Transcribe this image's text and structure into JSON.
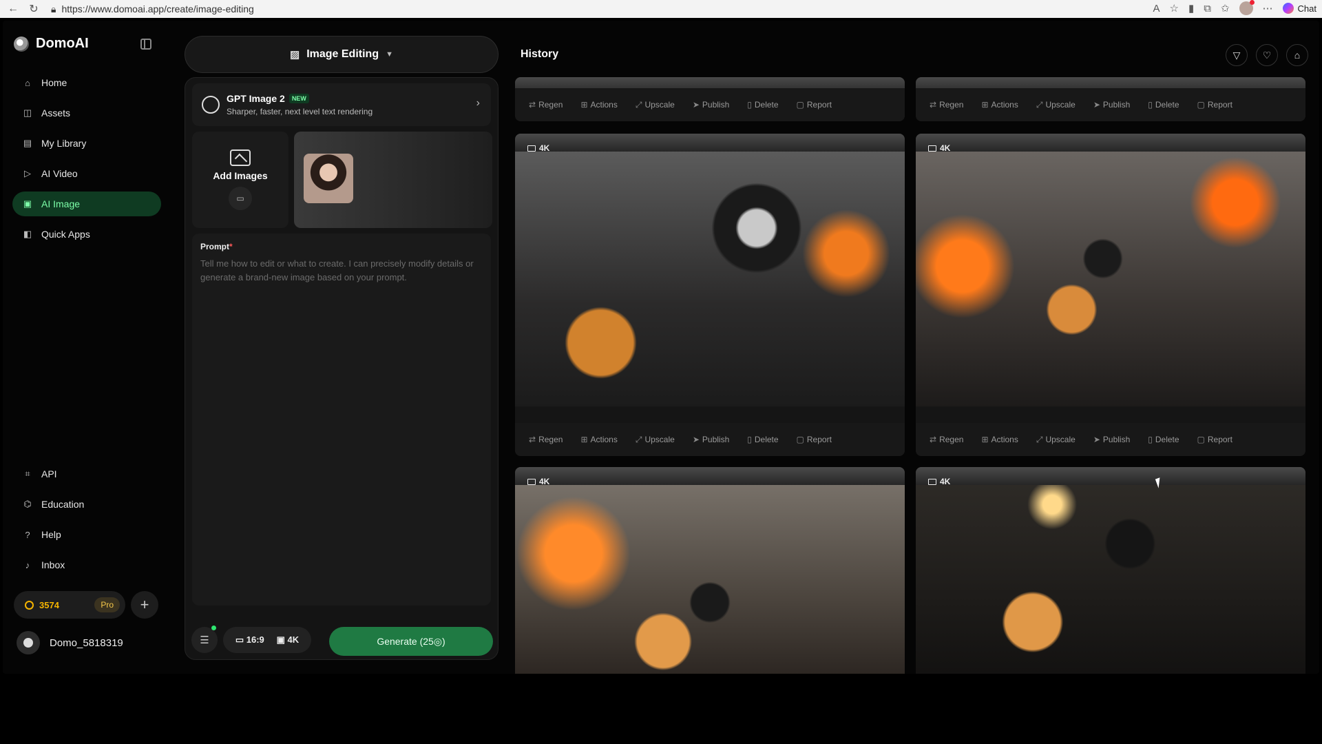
{
  "browser": {
    "url": "https://www.domoai.app/create/image-editing",
    "chat_label": "Chat"
  },
  "sidebar": {
    "brand": "DomoAI",
    "items": [
      {
        "label": "Home",
        "icon": "home-icon"
      },
      {
        "label": "Assets",
        "icon": "assets-icon"
      },
      {
        "label": "My Library",
        "icon": "library-icon"
      },
      {
        "label": "AI Video",
        "icon": "video-icon"
      },
      {
        "label": "AI Image",
        "icon": "image-icon",
        "active": true
      },
      {
        "label": "Quick Apps",
        "icon": "apps-icon"
      }
    ],
    "bottom_items": [
      {
        "label": "API",
        "icon": "api-icon"
      },
      {
        "label": "Education",
        "icon": "education-icon"
      },
      {
        "label": "Help",
        "icon": "help-icon"
      },
      {
        "label": "Inbox",
        "icon": "bell-icon"
      }
    ],
    "credits": "3574",
    "plan": "Pro",
    "username": "Domo_5818319"
  },
  "editor": {
    "mode": "Image Editing",
    "model_name": "GPT Image 2",
    "model_badge": "NEW",
    "model_desc": "Sharper, faster, next level text rendering",
    "add_images": "Add Images",
    "prompt_label": "Prompt",
    "prompt_required": "*",
    "prompt_placeholder": "Tell me how to edit or what to create. I can precisely modify details or generate a brand-new image based on your prompt.",
    "aspect": "16:9",
    "resolution": "4K",
    "generate_label": "Generate (25◎)"
  },
  "history": {
    "title": "History",
    "actions": [
      "Regen",
      "Actions",
      "Upscale",
      "Publish",
      "Delete",
      "Report"
    ],
    "badge": "4K"
  }
}
